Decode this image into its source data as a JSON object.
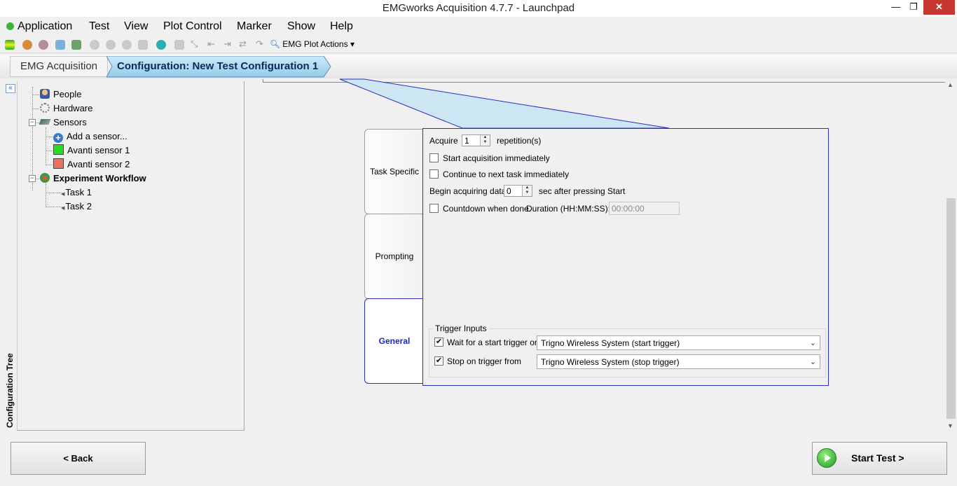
{
  "window": {
    "title": "EMGworks Acquisition 4.7.7 - Launchpad",
    "minimize_icon": "minimize-icon",
    "restore_icon": "restore-icon",
    "close_icon": "close-icon"
  },
  "menu": {
    "items": [
      "Application",
      "Test",
      "View",
      "Plot Control",
      "Marker",
      "Show",
      "Help"
    ]
  },
  "toolbar": {
    "plot_actions_label": "EMG Plot Actions"
  },
  "breadcrumb": {
    "items": [
      "EMG Acquisition",
      "Configuration: New Test Configuration 1"
    ]
  },
  "sidebar": {
    "title": "Configuration Tree",
    "collapse_glyph": "«"
  },
  "tree": {
    "people": "People",
    "hardware": "Hardware",
    "sensors": "Sensors",
    "add_sensor": "Add a sensor...",
    "sensor1": "Avanti sensor 1",
    "sensor2": "Avanti sensor 2",
    "workflow": "Experiment Workflow",
    "task1": "Task 1",
    "task2": "Task 2",
    "colors": {
      "sensor1": "#22dd22",
      "sensor2": "#f07060"
    }
  },
  "tabs": {
    "task_specific": "Task Specific",
    "prompting": "Prompting",
    "general": "General"
  },
  "task_specific": {
    "acquire_label": "Acquire",
    "acquire_value": "1",
    "repetitions_label": "repetition(s)",
    "start_immediately": "Start acquisition immediately",
    "start_immediately_checked": false,
    "continue_next": "Continue to next task immediately",
    "continue_next_checked": false,
    "begin_label": "Begin acquiring data",
    "begin_value": "0",
    "begin_suffix": "sec after pressing Start",
    "countdown_label": "Countdown when done.",
    "countdown_checked": false,
    "duration_label": "Duration (HH:MM:SS):",
    "duration_value": "00:00:00"
  },
  "general": {
    "trigger_title": "Trigger Inputs",
    "wait_label": "Wait for a start trigger on",
    "wait_checked": true,
    "wait_value": "Trigno Wireless System (start trigger)",
    "stop_label": "Stop on trigger from",
    "stop_checked": true,
    "stop_value": "Trigno Wireless System (stop trigger)"
  },
  "buttons": {
    "back": "< Back",
    "start": "Start Test >"
  },
  "colors": {
    "accent_blue": "#2d2dbf",
    "crumb_active": "#a9d6ee"
  }
}
